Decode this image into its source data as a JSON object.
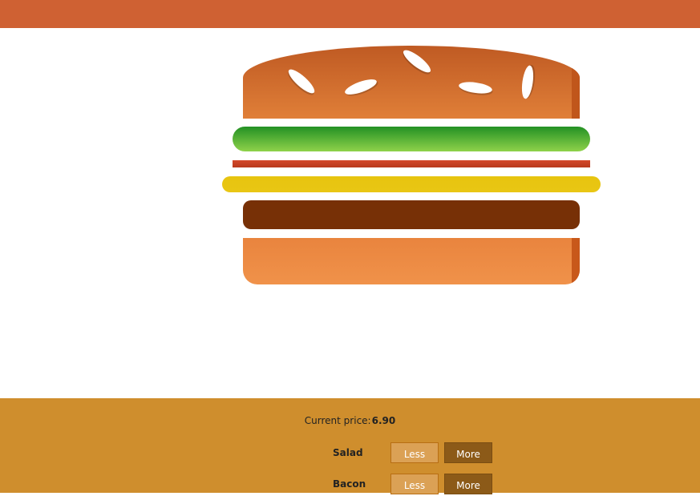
{
  "price": {
    "label": "Current price:",
    "value": "6.90"
  },
  "controls": [
    {
      "label": "Salad",
      "less": "Less",
      "more": "More"
    },
    {
      "label": "Bacon",
      "less": "Less",
      "more": "More"
    }
  ],
  "colors": {
    "header": "#cf6133",
    "controls_background": "#cf8e2d",
    "salad": "#3fa52c",
    "bacon": "#c4401f",
    "cheese": "#e7c40f",
    "meat": "#773006",
    "bun": "#e07f38"
  }
}
